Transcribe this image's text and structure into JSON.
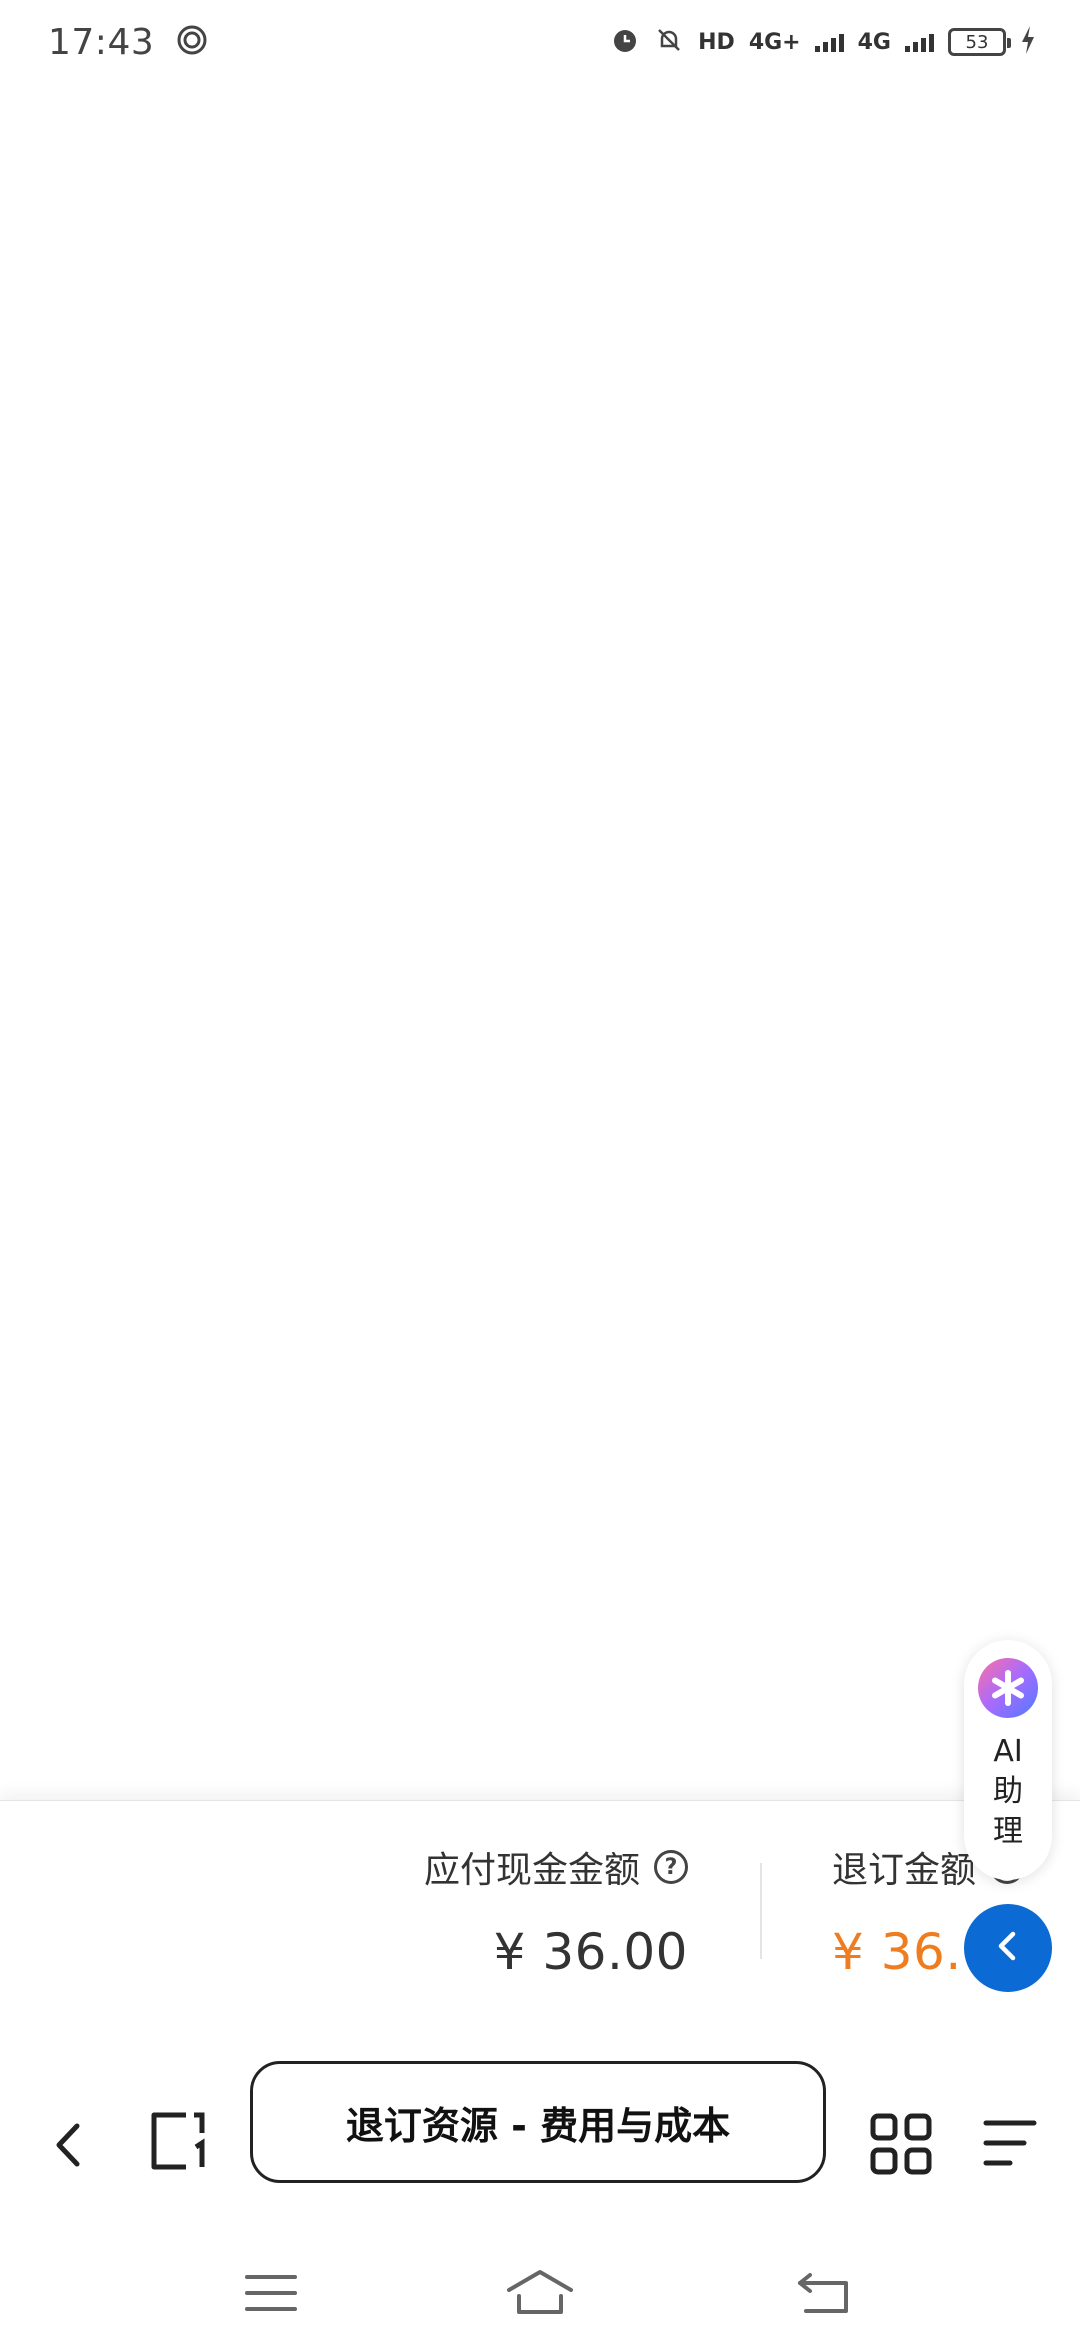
{
  "status_bar": {
    "time": "17:43",
    "hd_label": "HD",
    "network1": "4G+",
    "network2": "4G",
    "battery": "53"
  },
  "summary": {
    "payable_label": "应付现金金额",
    "payable_amount": "¥ 36.00",
    "refund_label": "退订金额",
    "refund_amount": "¥ 36.00"
  },
  "ai_assistant": {
    "label_line1": "AI",
    "label_line2": "助",
    "label_line3": "理"
  },
  "toolbar": {
    "page_title": "退订资源 - 费用与成本"
  },
  "colors": {
    "refund_orange": "#ef7d1f",
    "collapse_blue": "#0b6ad3"
  }
}
